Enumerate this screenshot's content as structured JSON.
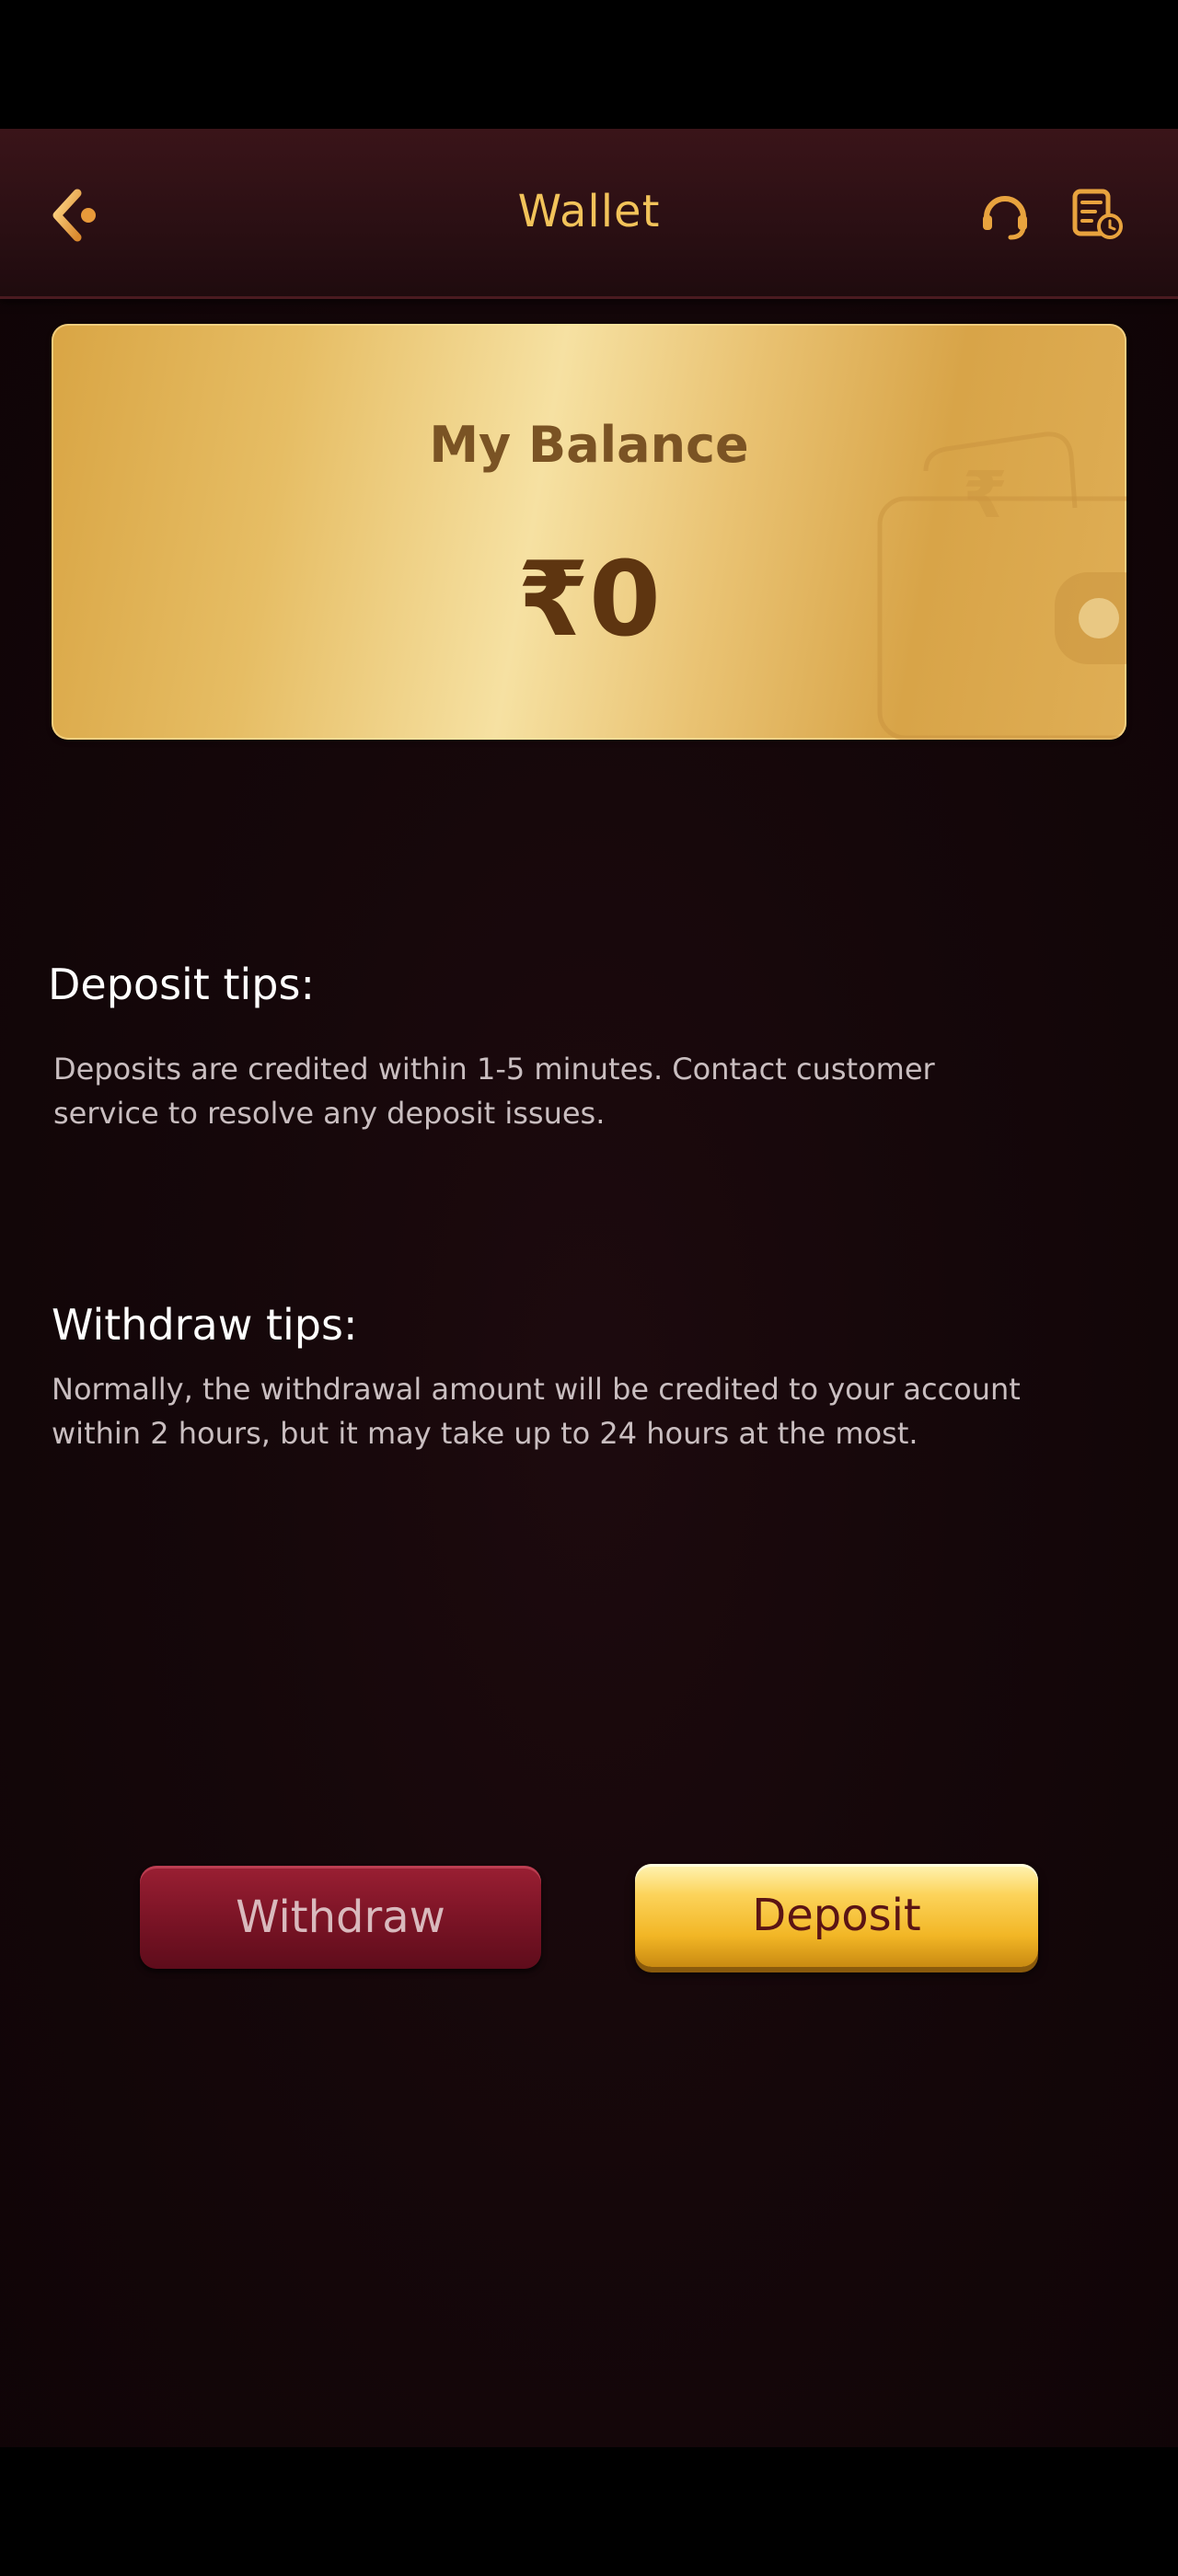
{
  "header": {
    "title": "Wallet",
    "back_icon": "chevron-left-icon",
    "support_icon": "headset-icon",
    "history_icon": "receipt-history-icon",
    "accent_color": "#f2c35a"
  },
  "balance": {
    "label": "My Balance",
    "amount": "₹0"
  },
  "deposit_tips": {
    "title": "Deposit tips:",
    "text": "Deposits are credited within 1-5 minutes. Contact customer service to resolve any deposit issues."
  },
  "withdraw_tips": {
    "title": "Withdraw tips:",
    "text": "Normally, the withdrawal amount will be credited to your account within 2 hours, but it may take up to 24 hours at the most."
  },
  "actions": {
    "withdraw_label": "Withdraw",
    "deposit_label": "Deposit",
    "withdraw_color": "#7c1426",
    "deposit_color": "#f2b625"
  }
}
